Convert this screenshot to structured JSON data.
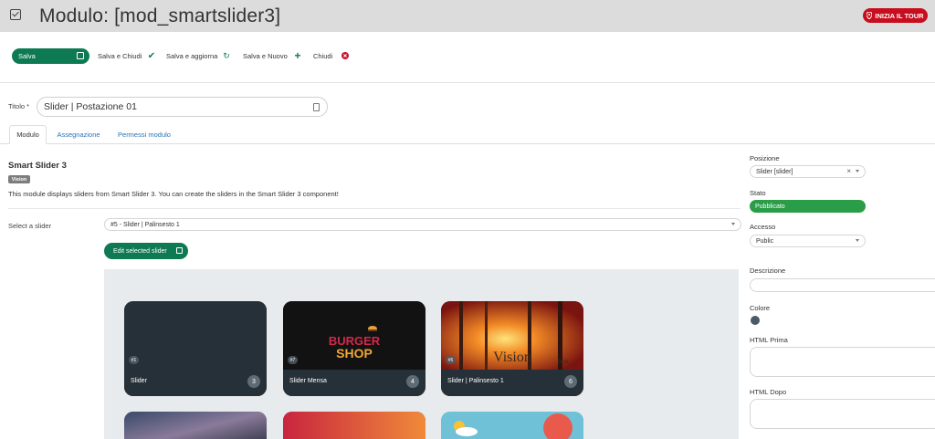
{
  "header": {
    "title": "Modulo: [mod_smartslider3]",
    "tour_label": "INIZIA IL TOUR"
  },
  "toolbar": {
    "save": "Salva",
    "save_close": "Salva e Chiudi",
    "save_update": "Salva e aggiorna",
    "save_new": "Salva e Nuovo",
    "close": "Chiudi"
  },
  "form": {
    "title_label": "Titolo *",
    "title_value": "Slider | Postazione 01"
  },
  "tabs": [
    {
      "label": "Modulo"
    },
    {
      "label": "Assegnazione"
    },
    {
      "label": "Permessi modulo"
    }
  ],
  "main": {
    "section_title": "Smart Slider 3",
    "badge": "Vision",
    "description": "This module displays sliders from Smart Slider 3. You can create the sliders in the Smart Slider 3 component!",
    "select_label": "Select a slider",
    "select_value": "#5 - Slider | Palinsesto 1",
    "edit_button": "Edit selected slider"
  },
  "sliders": [
    {
      "id": "#1",
      "name": "Slider",
      "count": "3"
    },
    {
      "id": "#7",
      "name": "Slider Mensa",
      "count": "4",
      "thumb_line1": "BURGER",
      "thumb_line2": "SHOP"
    },
    {
      "id": "#5",
      "name": "Slider | Palinsesto 1",
      "count": "6",
      "thumb_text": "Vision",
      "thumb_sub": "box"
    }
  ],
  "sidebar": {
    "position_label": "Posizione",
    "position_value": "Slider [slider]",
    "status_label": "Stato",
    "status_value": "Pubblicato",
    "access_label": "Accesso",
    "access_value": "Public",
    "description_label": "Descrizione",
    "color_label": "Colore",
    "html_before_label": "HTML Prima",
    "html_after_label": "HTML Dopo"
  },
  "colors": {
    "primary_green": "#0e7a53",
    "published_green": "#2a9d48",
    "tour_red": "#c80e1e",
    "link_blue": "#2a73b8",
    "module_color": "#4a5a66"
  }
}
